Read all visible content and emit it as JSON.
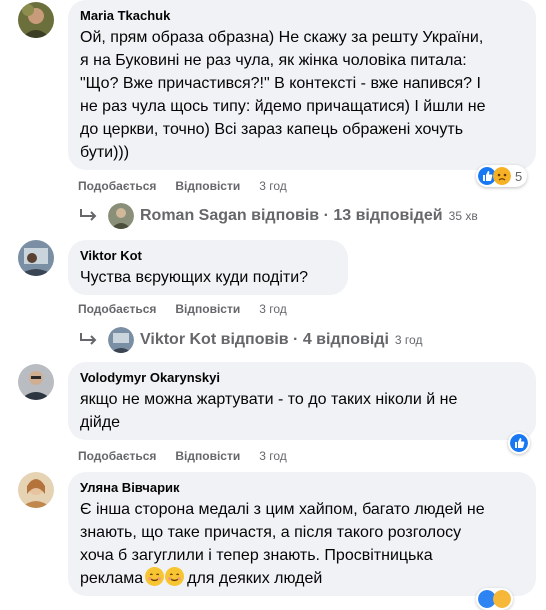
{
  "comments": [
    {
      "author": "Maria Tkachuk",
      "lines": [
        "Ой, прям образа образна) Не скажу за решту України,",
        "я на Буковині не раз чула, як жінка чоловіка питала:",
        "\"Що? Вже причастився?!\" В контексті - вже напився? І",
        "не раз чула щось типу: йдемо причащатися) І йшли не",
        "до церкви, точно) Всі зараз капець ображені хочуть",
        "бути)))"
      ],
      "like": "Подобається",
      "reply": "Відповісти",
      "time": "3 год",
      "reactions": {
        "count": "5",
        "icons": [
          "like-icon",
          "sad-face-icon"
        ]
      },
      "reply_summary": {
        "author": "Roman Sagan",
        "text": " відповів · 13 відповідей",
        "time": "35 хв"
      }
    },
    {
      "author": "Viktor Kot",
      "lines": [
        "Чуства вєрующих куди подіти?"
      ],
      "like": "Подобається",
      "reply": "Відповісти",
      "time": "3 год",
      "reply_summary": {
        "author": "Viktor Kot",
        "text": " відповів · 4 відповіді",
        "time": "3 год"
      }
    },
    {
      "author": "Volodymyr Okarynskyi",
      "lines": [
        "якщо не можна жартувати - то до таких ніколи й не",
        "дійде"
      ],
      "like": "Подобається",
      "reply": "Відповісти",
      "time": "3 год",
      "reactions": {
        "icons": [
          "like-icon"
        ]
      }
    },
    {
      "author": "Уляна Вівчарик",
      "lines": [
        "Є інша сторона медалі з цим хайпом, багато людей не",
        "знають, що таке причастя, а після такого розголосу",
        "хоча б загуглили і тепер знають. Просвітницька",
        "реклама",
        "для деяких людей"
      ],
      "like": "Подобається",
      "reply": "Відповісти",
      "time": "3 год"
    }
  ],
  "colors": {
    "bubble": "#f0f2f5",
    "meta": "#65676b",
    "like_blue": "#1877f2"
  }
}
